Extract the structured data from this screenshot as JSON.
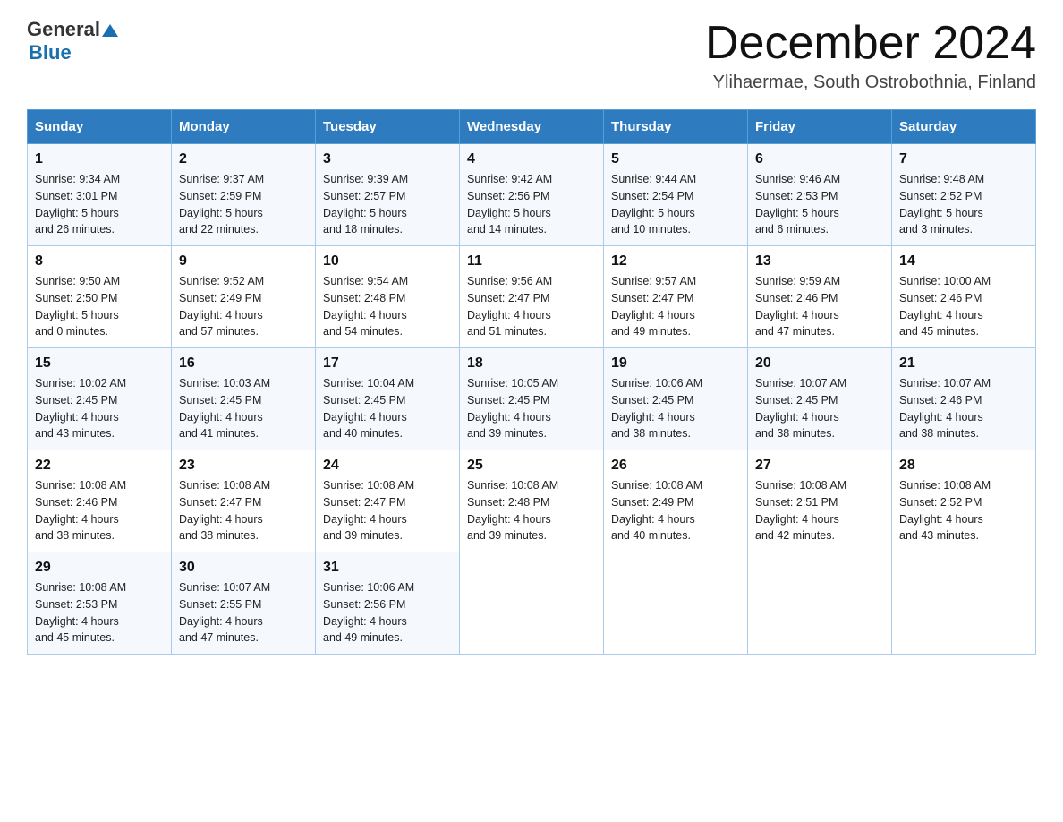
{
  "header": {
    "logo": {
      "general": "General",
      "arrow": "▶",
      "blue": "Blue"
    },
    "month_title": "December 2024",
    "location": "Ylihaermae, South Ostrobothnia, Finland"
  },
  "weekdays": [
    "Sunday",
    "Monday",
    "Tuesday",
    "Wednesday",
    "Thursday",
    "Friday",
    "Saturday"
  ],
  "weeks": [
    [
      {
        "day": "1",
        "sunrise": "Sunrise: 9:34 AM",
        "sunset": "Sunset: 3:01 PM",
        "daylight": "Daylight: 5 hours",
        "daylight2": "and 26 minutes."
      },
      {
        "day": "2",
        "sunrise": "Sunrise: 9:37 AM",
        "sunset": "Sunset: 2:59 PM",
        "daylight": "Daylight: 5 hours",
        "daylight2": "and 22 minutes."
      },
      {
        "day": "3",
        "sunrise": "Sunrise: 9:39 AM",
        "sunset": "Sunset: 2:57 PM",
        "daylight": "Daylight: 5 hours",
        "daylight2": "and 18 minutes."
      },
      {
        "day": "4",
        "sunrise": "Sunrise: 9:42 AM",
        "sunset": "Sunset: 2:56 PM",
        "daylight": "Daylight: 5 hours",
        "daylight2": "and 14 minutes."
      },
      {
        "day": "5",
        "sunrise": "Sunrise: 9:44 AM",
        "sunset": "Sunset: 2:54 PM",
        "daylight": "Daylight: 5 hours",
        "daylight2": "and 10 minutes."
      },
      {
        "day": "6",
        "sunrise": "Sunrise: 9:46 AM",
        "sunset": "Sunset: 2:53 PM",
        "daylight": "Daylight: 5 hours",
        "daylight2": "and 6 minutes."
      },
      {
        "day": "7",
        "sunrise": "Sunrise: 9:48 AM",
        "sunset": "Sunset: 2:52 PM",
        "daylight": "Daylight: 5 hours",
        "daylight2": "and 3 minutes."
      }
    ],
    [
      {
        "day": "8",
        "sunrise": "Sunrise: 9:50 AM",
        "sunset": "Sunset: 2:50 PM",
        "daylight": "Daylight: 5 hours",
        "daylight2": "and 0 minutes."
      },
      {
        "day": "9",
        "sunrise": "Sunrise: 9:52 AM",
        "sunset": "Sunset: 2:49 PM",
        "daylight": "Daylight: 4 hours",
        "daylight2": "and 57 minutes."
      },
      {
        "day": "10",
        "sunrise": "Sunrise: 9:54 AM",
        "sunset": "Sunset: 2:48 PM",
        "daylight": "Daylight: 4 hours",
        "daylight2": "and 54 minutes."
      },
      {
        "day": "11",
        "sunrise": "Sunrise: 9:56 AM",
        "sunset": "Sunset: 2:47 PM",
        "daylight": "Daylight: 4 hours",
        "daylight2": "and 51 minutes."
      },
      {
        "day": "12",
        "sunrise": "Sunrise: 9:57 AM",
        "sunset": "Sunset: 2:47 PM",
        "daylight": "Daylight: 4 hours",
        "daylight2": "and 49 minutes."
      },
      {
        "day": "13",
        "sunrise": "Sunrise: 9:59 AM",
        "sunset": "Sunset: 2:46 PM",
        "daylight": "Daylight: 4 hours",
        "daylight2": "and 47 minutes."
      },
      {
        "day": "14",
        "sunrise": "Sunrise: 10:00 AM",
        "sunset": "Sunset: 2:46 PM",
        "daylight": "Daylight: 4 hours",
        "daylight2": "and 45 minutes."
      }
    ],
    [
      {
        "day": "15",
        "sunrise": "Sunrise: 10:02 AM",
        "sunset": "Sunset: 2:45 PM",
        "daylight": "Daylight: 4 hours",
        "daylight2": "and 43 minutes."
      },
      {
        "day": "16",
        "sunrise": "Sunrise: 10:03 AM",
        "sunset": "Sunset: 2:45 PM",
        "daylight": "Daylight: 4 hours",
        "daylight2": "and 41 minutes."
      },
      {
        "day": "17",
        "sunrise": "Sunrise: 10:04 AM",
        "sunset": "Sunset: 2:45 PM",
        "daylight": "Daylight: 4 hours",
        "daylight2": "and 40 minutes."
      },
      {
        "day": "18",
        "sunrise": "Sunrise: 10:05 AM",
        "sunset": "Sunset: 2:45 PM",
        "daylight": "Daylight: 4 hours",
        "daylight2": "and 39 minutes."
      },
      {
        "day": "19",
        "sunrise": "Sunrise: 10:06 AM",
        "sunset": "Sunset: 2:45 PM",
        "daylight": "Daylight: 4 hours",
        "daylight2": "and 38 minutes."
      },
      {
        "day": "20",
        "sunrise": "Sunrise: 10:07 AM",
        "sunset": "Sunset: 2:45 PM",
        "daylight": "Daylight: 4 hours",
        "daylight2": "and 38 minutes."
      },
      {
        "day": "21",
        "sunrise": "Sunrise: 10:07 AM",
        "sunset": "Sunset: 2:46 PM",
        "daylight": "Daylight: 4 hours",
        "daylight2": "and 38 minutes."
      }
    ],
    [
      {
        "day": "22",
        "sunrise": "Sunrise: 10:08 AM",
        "sunset": "Sunset: 2:46 PM",
        "daylight": "Daylight: 4 hours",
        "daylight2": "and 38 minutes."
      },
      {
        "day": "23",
        "sunrise": "Sunrise: 10:08 AM",
        "sunset": "Sunset: 2:47 PM",
        "daylight": "Daylight: 4 hours",
        "daylight2": "and 38 minutes."
      },
      {
        "day": "24",
        "sunrise": "Sunrise: 10:08 AM",
        "sunset": "Sunset: 2:47 PM",
        "daylight": "Daylight: 4 hours",
        "daylight2": "and 39 minutes."
      },
      {
        "day": "25",
        "sunrise": "Sunrise: 10:08 AM",
        "sunset": "Sunset: 2:48 PM",
        "daylight": "Daylight: 4 hours",
        "daylight2": "and 39 minutes."
      },
      {
        "day": "26",
        "sunrise": "Sunrise: 10:08 AM",
        "sunset": "Sunset: 2:49 PM",
        "daylight": "Daylight: 4 hours",
        "daylight2": "and 40 minutes."
      },
      {
        "day": "27",
        "sunrise": "Sunrise: 10:08 AM",
        "sunset": "Sunset: 2:51 PM",
        "daylight": "Daylight: 4 hours",
        "daylight2": "and 42 minutes."
      },
      {
        "day": "28",
        "sunrise": "Sunrise: 10:08 AM",
        "sunset": "Sunset: 2:52 PM",
        "daylight": "Daylight: 4 hours",
        "daylight2": "and 43 minutes."
      }
    ],
    [
      {
        "day": "29",
        "sunrise": "Sunrise: 10:08 AM",
        "sunset": "Sunset: 2:53 PM",
        "daylight": "Daylight: 4 hours",
        "daylight2": "and 45 minutes."
      },
      {
        "day": "30",
        "sunrise": "Sunrise: 10:07 AM",
        "sunset": "Sunset: 2:55 PM",
        "daylight": "Daylight: 4 hours",
        "daylight2": "and 47 minutes."
      },
      {
        "day": "31",
        "sunrise": "Sunrise: 10:06 AM",
        "sunset": "Sunset: 2:56 PM",
        "daylight": "Daylight: 4 hours",
        "daylight2": "and 49 minutes."
      },
      null,
      null,
      null,
      null
    ]
  ]
}
